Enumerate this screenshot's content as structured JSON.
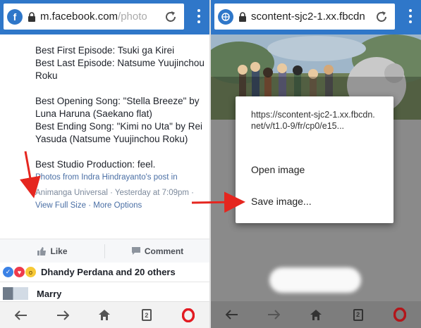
{
  "left": {
    "url_host": "m.facebook.com",
    "url_path": "/photo",
    "post_lines": [
      [
        "Best First Episode: Tsuki ga Kirei",
        "Best Last Episode: Natsume Yuujinchou Roku"
      ],
      [
        "Best Opening Song: \"Stella Breeze\" by Luna Haruna (Saekano flat)",
        "Best Ending Song: \"Kimi no Uta\" by Rei Yasuda (Natsume Yuujinchou Roku)"
      ],
      [
        "Best Studio Production: feel."
      ]
    ],
    "photos_from": "Photos from Indra Hindrayanto's post in",
    "group_time": "Animanga Universal · Yesterday at 7:09pm ·",
    "view_full_size": "View Full Size",
    "more_options": "More Options",
    "like_label": "Like",
    "comment_label": "Comment",
    "reactions_text": "Dhandy Perdana and 20 others",
    "commenter_name": "Marry",
    "tab_count": "2"
  },
  "right": {
    "url": "scontent-sjc2-1.xx.fbcdn",
    "context_url": "https://scontent-sjc2-1.xx.fbcdn.net/v/t1.0-9/fr/cp0/e15...",
    "open_image": "Open image",
    "save_image": "Save image...",
    "tab_count": "2"
  },
  "colors": {
    "fb_blue": "#2f77c9",
    "arrow_red": "#e5261f",
    "opera_red": "#e21b22"
  }
}
